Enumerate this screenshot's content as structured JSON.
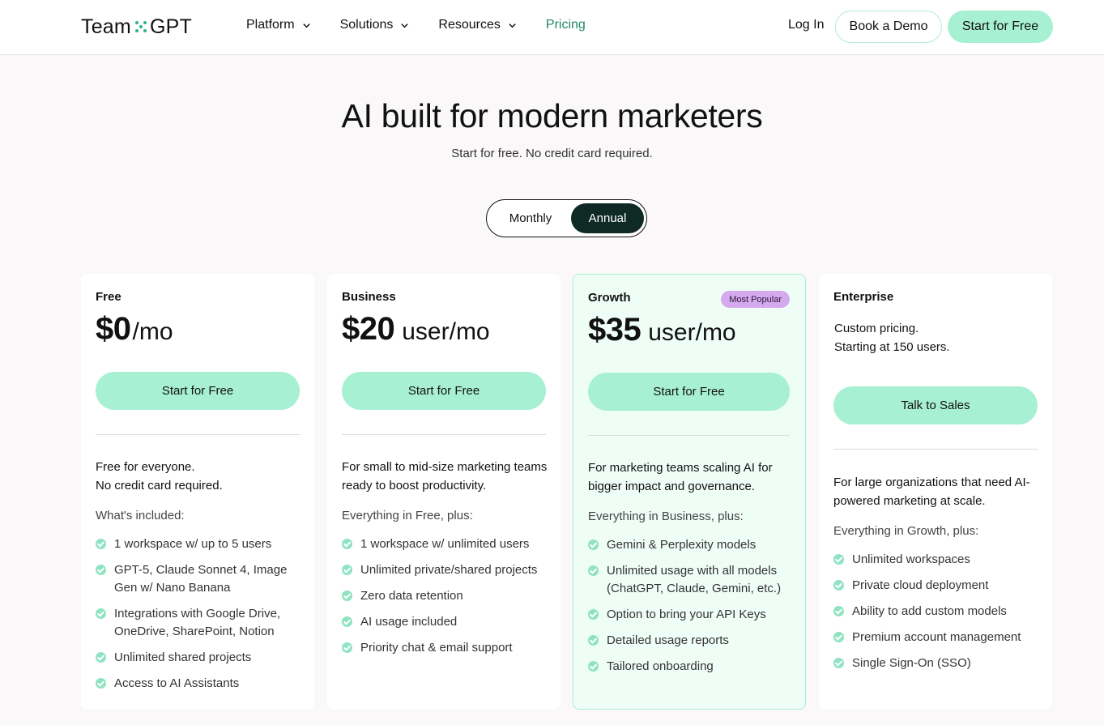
{
  "header": {
    "logo_left": "Team",
    "logo_right": "GPT",
    "nav": [
      "Platform",
      "Solutions",
      "Resources",
      "Pricing"
    ],
    "login": "Log In",
    "demo": "Book a Demo",
    "start": "Start for Free",
    "accent_color": "#1f8a5f"
  },
  "hero": {
    "title": "AI built for modern marketers",
    "subtitle": "Start for free. No credit card required.",
    "toggle": {
      "monthly": "Monthly",
      "annual": "Annual",
      "selected": "Annual"
    }
  },
  "plans": [
    {
      "name": "Free",
      "amount": "$0",
      "unit": "/mo",
      "cta": "Start for Free",
      "description": [
        "Free for everyone.",
        "No credit card required."
      ],
      "included_label": "What's included:",
      "features": [
        "1 workspace w/ up to 5 users",
        "GPT-5, Claude Sonnet 4, Image Gen w/ Nano Banana",
        "Integrations with Google Drive, OneDrive, SharePoint, Notion",
        "Unlimited shared projects",
        "Access to AI Assistants"
      ]
    },
    {
      "name": "Business",
      "amount": "$20",
      "unit": "user/mo",
      "cta": "Start for Free",
      "description": [
        "For small to mid-size marketing teams ready to boost productivity."
      ],
      "included_label": "Everything in Free, plus:",
      "features": [
        "1 workspace w/ unlimited users",
        "Unlimited private/shared projects",
        "Zero data retention",
        "AI usage included",
        "Priority chat & email support"
      ]
    },
    {
      "name": "Growth",
      "badge": "Most Popular",
      "amount": "$35",
      "unit": "user/mo",
      "cta": "Start for Free",
      "description": [
        "For marketing teams scaling AI for bigger impact and governance."
      ],
      "included_label": "Everything in Business, plus:",
      "features": [
        "Gemini & Perplexity models",
        "Unlimited usage with all models (ChatGPT, Claude, Gemini, etc.)",
        "Option to bring your API Keys",
        "Detailed usage reports",
        "Tailored onboarding"
      ]
    },
    {
      "name": "Enterprise",
      "custom_line1": "Custom pricing.",
      "custom_line2": "Starting at 150 users.",
      "cta": "Talk to Sales",
      "description": [
        "For large organizations that need AI-powered marketing at scale."
      ],
      "included_label": "Everything in Growth, plus:",
      "features": [
        "Unlimited workspaces",
        "Private cloud deployment",
        "Ability to add custom models",
        "Premium account management",
        "Single Sign-On (SSO)"
      ]
    }
  ]
}
